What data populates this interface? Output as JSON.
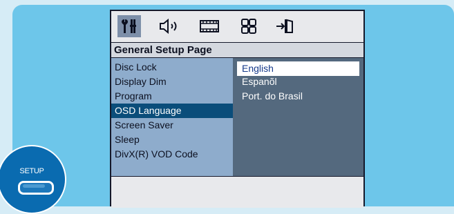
{
  "window": {
    "page_title": "General Setup Page"
  },
  "tabs": [
    {
      "icon": "general-setup-icon",
      "active": true
    },
    {
      "icon": "audio-speaker-icon",
      "active": false
    },
    {
      "icon": "video-film-icon",
      "active": false
    },
    {
      "icon": "preference-grid-icon",
      "active": false
    },
    {
      "icon": "exit-door-icon",
      "active": false
    }
  ],
  "menu": {
    "items": [
      {
        "label": "Disc Lock"
      },
      {
        "label": "Display Dim"
      },
      {
        "label": "Program"
      },
      {
        "label": "OSD Language",
        "selected": true
      },
      {
        "label": "Screen Saver"
      },
      {
        "label": "Sleep"
      },
      {
        "label": "DivX(R) VOD Code"
      }
    ]
  },
  "options": {
    "items": [
      {
        "label": "English",
        "highlighted": true
      },
      {
        "label": "Espanõl"
      },
      {
        "label": "Port. do Brasil"
      }
    ]
  },
  "remote": {
    "setup_label": "SETUP"
  },
  "colors": {
    "panel": "#6dc6ea",
    "left_menu": "#8eaccc",
    "right_menu": "#54697e",
    "selected": "#0a4d7a",
    "setup_button": "#0a6bb0"
  }
}
